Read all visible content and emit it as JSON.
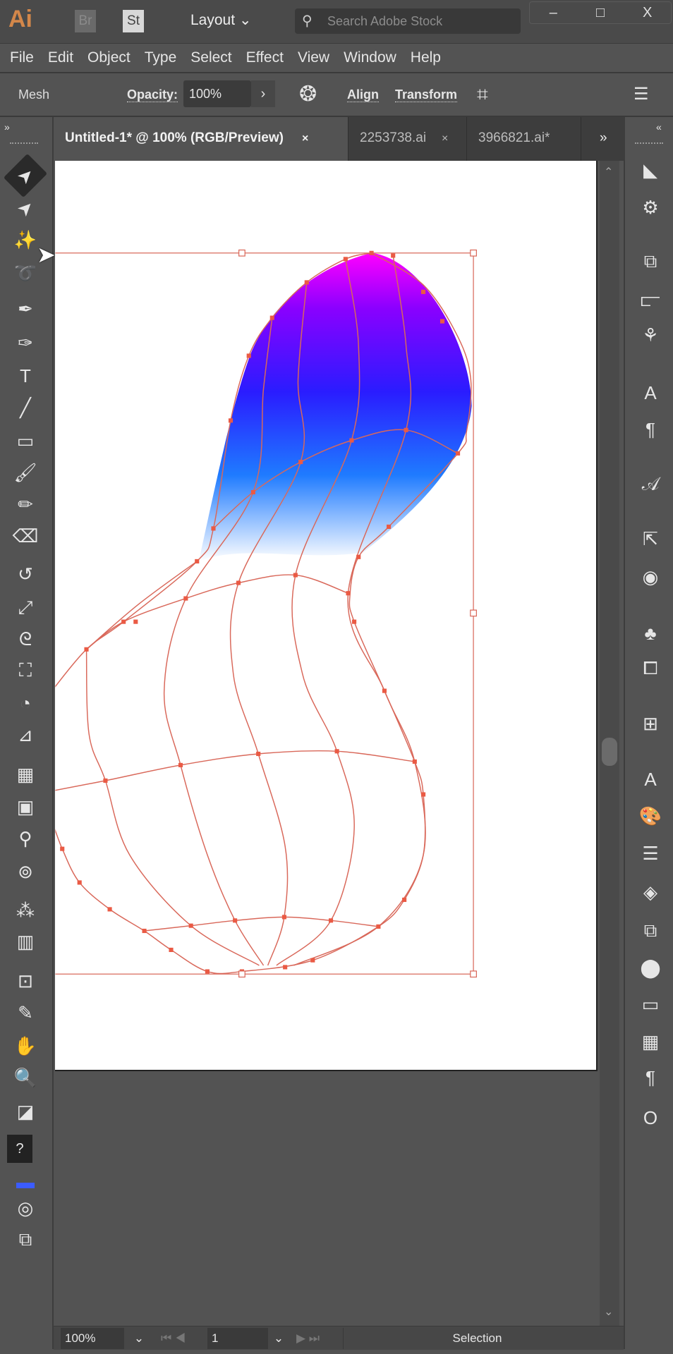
{
  "app": {
    "logo": "Ai",
    "bridge": "Br",
    "stock": "St",
    "workspace": "Layout",
    "search_placeholder": "Search Adobe Stock",
    "window_controls": [
      "–",
      "□",
      "X"
    ]
  },
  "menu": [
    "File",
    "Edit",
    "Object",
    "Type",
    "Select",
    "Effect",
    "View",
    "Window",
    "Help"
  ],
  "control_bar": {
    "selection_label": "Mesh",
    "opacity_label": "Opacity:",
    "opacity_value": "100%",
    "align": "Align",
    "transform": "Transform"
  },
  "tabs": [
    {
      "label": "Untitled-1* @ 100% (RGB/Preview)",
      "active": true,
      "close": "×"
    },
    {
      "label": "2253738.ai",
      "active": false,
      "close": "×"
    },
    {
      "label": "3966821.ai*",
      "active": false
    }
  ],
  "tabs_overflow": "»",
  "status_bar": {
    "zoom": "100%",
    "artboard": "1",
    "tool": "Selection"
  },
  "left_tools": [
    {
      "name": "selection-tool",
      "icon": "➤",
      "selected": true
    },
    {
      "name": "direct-selection-tool",
      "icon": "➤"
    },
    {
      "name": "magic-wand-tool",
      "icon": "✨"
    },
    {
      "name": "lasso-tool",
      "icon": "➰"
    },
    {
      "name": "pen-tool",
      "icon": "✒"
    },
    {
      "name": "curvature-tool",
      "icon": "✑"
    },
    {
      "name": "type-tool",
      "icon": "T"
    },
    {
      "name": "line-tool",
      "icon": "╱"
    },
    {
      "name": "rectangle-tool",
      "icon": "▭"
    },
    {
      "name": "paintbrush-tool",
      "icon": "🖌"
    },
    {
      "name": "pencil-tool",
      "icon": "✏"
    },
    {
      "name": "eraser-tool",
      "icon": "⌫"
    },
    {
      "name": "rotate-tool",
      "icon": "↺"
    },
    {
      "name": "scale-tool",
      "icon": "⤢"
    },
    {
      "name": "warp-tool",
      "icon": "ᘓ"
    },
    {
      "name": "free-transform-tool",
      "icon": "⛶"
    },
    {
      "name": "shape-builder-tool",
      "icon": "◔"
    },
    {
      "name": "perspective-grid-tool",
      "icon": "⊿"
    },
    {
      "name": "mesh-tool",
      "icon": "▦"
    },
    {
      "name": "gradient-tool",
      "icon": "▣"
    },
    {
      "name": "eyedropper-tool",
      "icon": "⚲"
    },
    {
      "name": "blend-tool",
      "icon": "⊚"
    },
    {
      "name": "symbol-sprayer-tool",
      "icon": "⁂"
    },
    {
      "name": "column-graph-tool",
      "icon": "▥"
    },
    {
      "name": "artboard-tool",
      "icon": "⊡"
    },
    {
      "name": "slice-tool",
      "icon": "✎"
    },
    {
      "name": "hand-tool",
      "icon": "✋"
    },
    {
      "name": "zoom-tool",
      "icon": "🔍"
    },
    {
      "name": "default-fill-stroke",
      "icon": "◪"
    },
    {
      "name": "fill-stroke-swatch",
      "icon": "?"
    },
    {
      "name": "color-modes",
      "icon": "▬"
    },
    {
      "name": "draw-modes",
      "icon": "◎"
    },
    {
      "name": "screen-mode",
      "icon": "⧉"
    }
  ],
  "right_panels": [
    {
      "name": "color-guide-icon",
      "icon": "◣"
    },
    {
      "name": "appearance-icon",
      "icon": "⚙"
    },
    {
      "name": "pathfinder-icon",
      "icon": "⧉"
    },
    {
      "name": "align-panel-icon",
      "icon": "⫍"
    },
    {
      "name": "asset-export-icon",
      "icon": "⚘"
    },
    {
      "name": "character-styles-icon",
      "icon": "A"
    },
    {
      "name": "paragraph-styles-icon",
      "icon": "¶"
    },
    {
      "name": "glyphs-icon",
      "icon": "𝒜"
    },
    {
      "name": "export-icon",
      "icon": "⇱"
    },
    {
      "name": "transparency-icon",
      "icon": "◉"
    },
    {
      "name": "symbols-icon",
      "icon": "♣"
    },
    {
      "name": "artboards-icon",
      "icon": "⧠"
    },
    {
      "name": "transform-panel-icon",
      "icon": "⊞"
    },
    {
      "name": "character-icon",
      "icon": "A"
    },
    {
      "name": "swatches-icon",
      "icon": "🎨"
    },
    {
      "name": "stroke-icon",
      "icon": "☰"
    },
    {
      "name": "layers-icon",
      "icon": "◈"
    },
    {
      "name": "links-icon",
      "icon": "⧉"
    },
    {
      "name": "color-icon",
      "icon": "⬤"
    },
    {
      "name": "gradient-icon",
      "icon": "▭"
    },
    {
      "name": "graphic-styles-icon",
      "icon": "▦"
    },
    {
      "name": "paragraph-icon",
      "icon": "¶"
    },
    {
      "name": "opentype-icon",
      "icon": "O"
    }
  ],
  "colors": {
    "mesh": "#d9685a",
    "anchor": "#ea5a44",
    "grad_top": "#ff00ff",
    "grad_mid": "#2a1cff",
    "grad_low": "#1f7bff"
  }
}
